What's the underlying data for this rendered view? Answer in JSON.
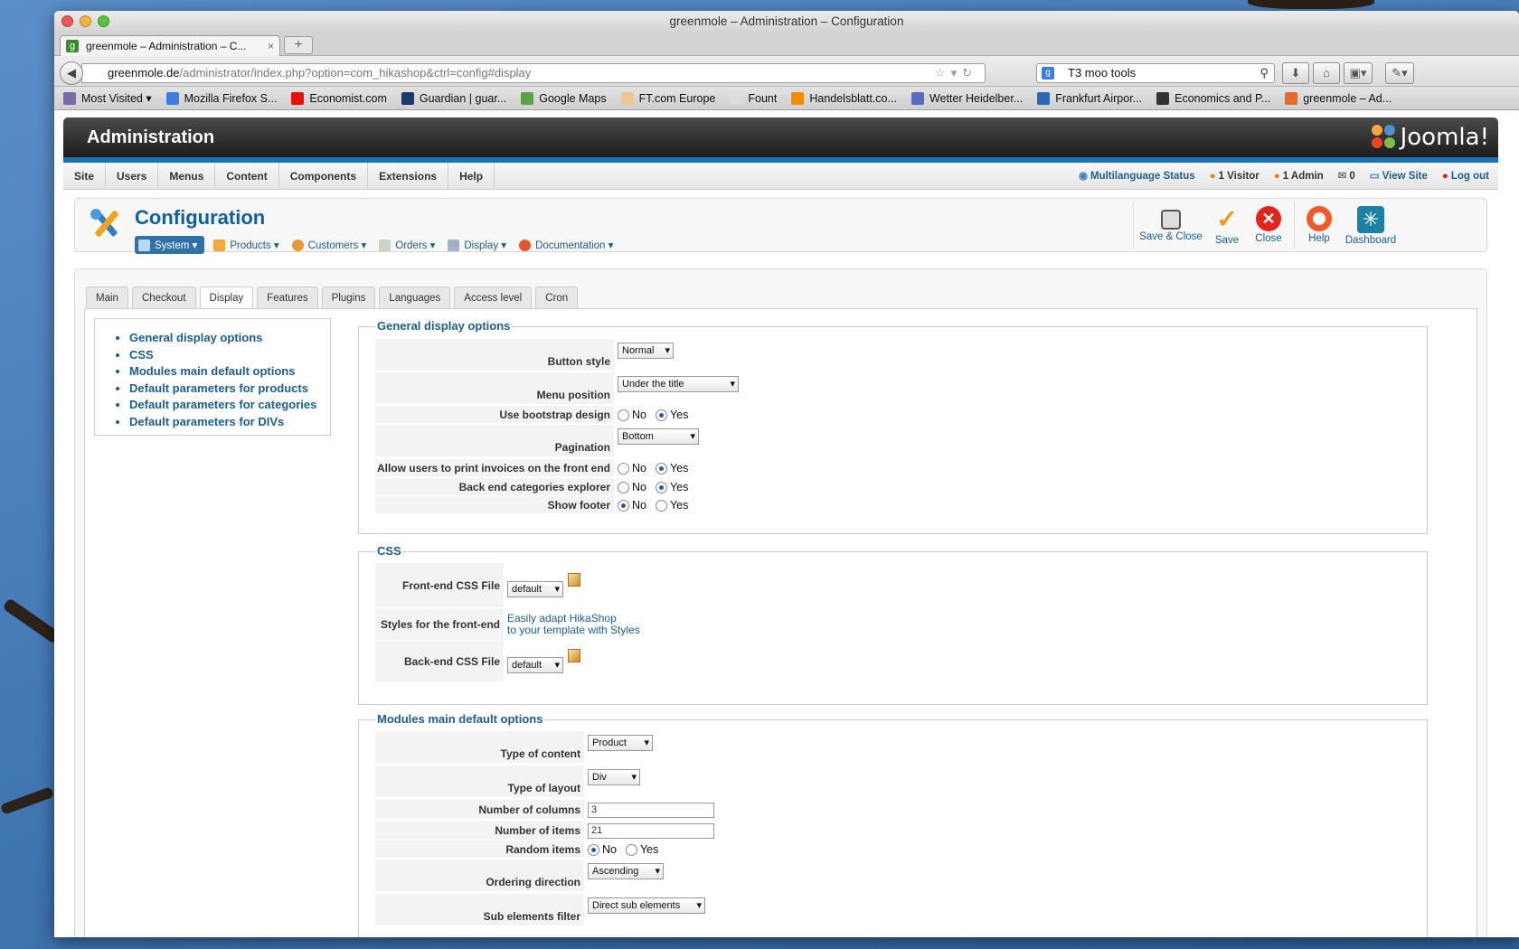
{
  "window_title": "greenmole – Administration – Configuration",
  "browser": {
    "tab_title": "greenmole – Administration – C...",
    "tab_close": "×",
    "new_tab": "+",
    "url_host": "greenmole.de",
    "url_path": "/administrator/index.php?option=com_hikashop&ctrl=config#display",
    "search_value": "T3 moo tools",
    "bookmarks": [
      {
        "label": "Most Visited ▾",
        "color": "#7b6aa8"
      },
      {
        "label": "Mozilla Firefox S...",
        "color": "#3d7de0"
      },
      {
        "label": "Economist.com",
        "color": "#e3120b"
      },
      {
        "label": "Guardian | guar...",
        "color": "#1d3b6a"
      },
      {
        "label": "Google Maps",
        "color": "#5ba345"
      },
      {
        "label": "FT.com Europe",
        "color": "#f0c58f"
      },
      {
        "label": "Fount",
        "color": "#dddddd"
      },
      {
        "label": "Handelsblatt.co...",
        "color": "#f28c00"
      },
      {
        "label": "Wetter Heidelber...",
        "color": "#5a6bb8"
      },
      {
        "label": "Frankfurt Airpor...",
        "color": "#2b68b0"
      },
      {
        "label": "Economics and P...",
        "color": "#333333"
      },
      {
        "label": "greenmole – Ad...",
        "color": "#e46b2a"
      }
    ]
  },
  "admin": {
    "header_title": "Administration",
    "brand": "Joomla!",
    "menu": [
      "Site",
      "Users",
      "Menus",
      "Content",
      "Components",
      "Extensions",
      "Help"
    ],
    "status": {
      "multilanguage": "Multilanguage Status",
      "visitors": "1 Visitor",
      "admins": "1 Admin",
      "messages": "0",
      "view_site": "View Site",
      "logout": "Log out"
    }
  },
  "config": {
    "title": "Configuration",
    "submenu": {
      "system": "System ▾",
      "products": "Products ▾",
      "customers": "Customers ▾",
      "orders": "Orders ▾",
      "display": "Display ▾",
      "documentation": "Documentation ▾"
    },
    "toolbar": {
      "save_close": "Save & Close",
      "save": "Save",
      "close": "Close",
      "help": "Help",
      "dashboard": "Dashboard"
    },
    "tabs": [
      "Main",
      "Checkout",
      "Display",
      "Features",
      "Plugins",
      "Languages",
      "Access level",
      "Cron"
    ],
    "active_tab": "Display",
    "toc": [
      "General display options",
      "CSS",
      "Modules main default options",
      "Default parameters for products",
      "Default parameters for categories",
      "Default parameters for DIVs"
    ]
  },
  "general": {
    "legend": "General display options",
    "button_style_label": "Button style",
    "button_style_value": "Normal",
    "menu_position_label": "Menu position",
    "menu_position_value": "Under the title",
    "bootstrap_label": "Use bootstrap design",
    "pagination_label": "Pagination",
    "pagination_value": "Bottom",
    "print_invoices_label": "Allow users to print invoices on the front end",
    "categories_explorer_label": "Back end categories explorer",
    "show_footer_label": "Show footer",
    "no": "No",
    "yes": "Yes"
  },
  "css": {
    "legend": "CSS",
    "frontend_label": "Front-end CSS File",
    "frontend_value": "default",
    "styles_label": "Styles for the front-end",
    "styles_link_1": "Easily adapt HikaShop",
    "styles_link_2": "to your template with Styles",
    "backend_label": "Back-end CSS File",
    "backend_value": "default"
  },
  "modules": {
    "legend": "Modules main default options",
    "type_content_label": "Type of content",
    "type_content_value": "Product",
    "type_layout_label": "Type of layout",
    "type_layout_value": "Div",
    "columns_label": "Number of columns",
    "columns_value": "3",
    "items_label": "Number of items",
    "items_value": "21",
    "random_label": "Random items",
    "ordering_label": "Ordering direction",
    "ordering_value": "Ascending",
    "sub_filter_label": "Sub elements filter",
    "sub_filter_value": "Direct sub elements",
    "no": "No",
    "yes": "Yes"
  }
}
